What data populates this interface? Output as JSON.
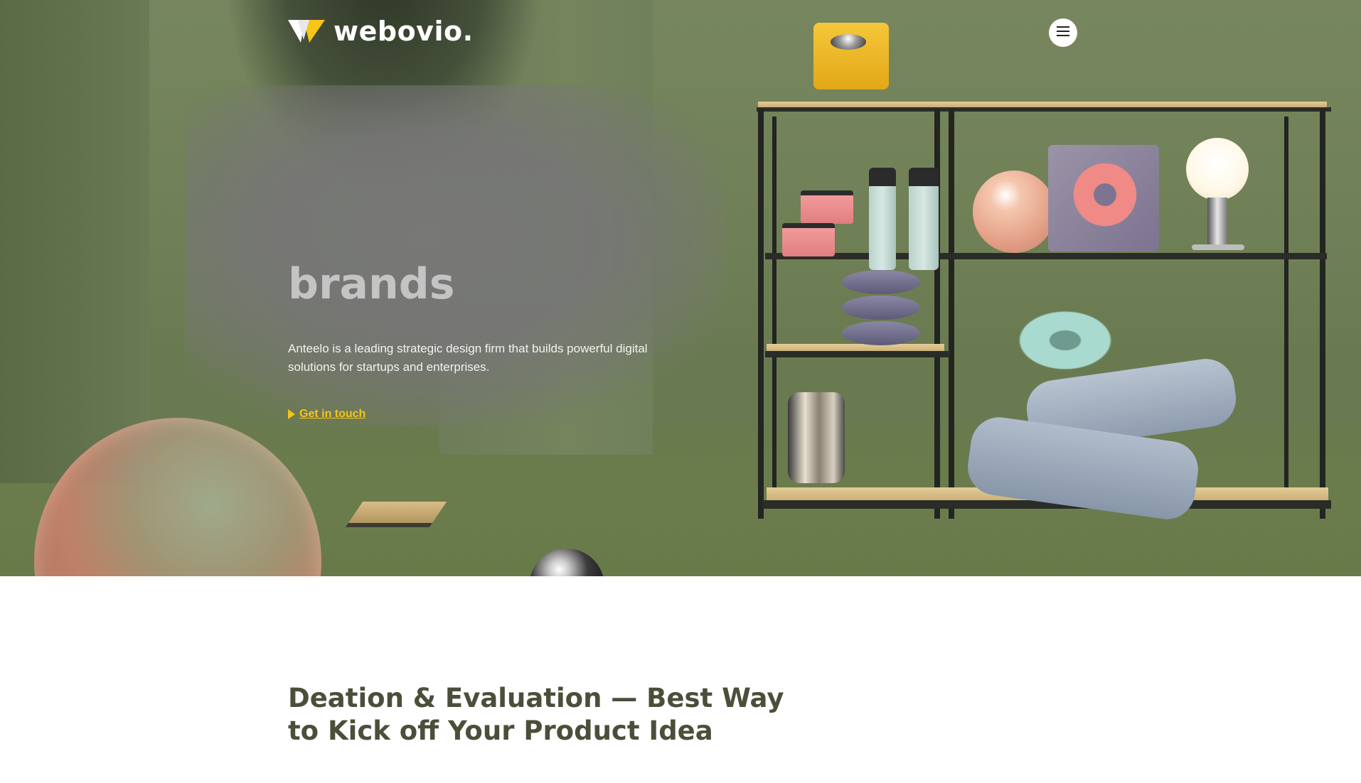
{
  "brand": {
    "name": "webovio."
  },
  "header": {
    "menu_icon": "hamburger-menu-icon"
  },
  "hero": {
    "title_lines": [
      "",
      "",
      "brands"
    ],
    "description": "Anteelo is a leading strategic design firm that builds powerful digital solutions for startups and enterprises.",
    "cta_label": "Get in touch",
    "cta_icon": "play-triangle-icon"
  },
  "section": {
    "title": "Deation & Evaluation — Best Way to Kick off Your Product Idea"
  },
  "colors": {
    "hero_bg": "#6f7f55",
    "accent": "#f5c518",
    "heading": "#4b4f3a",
    "page_bg": "#ffffff"
  }
}
